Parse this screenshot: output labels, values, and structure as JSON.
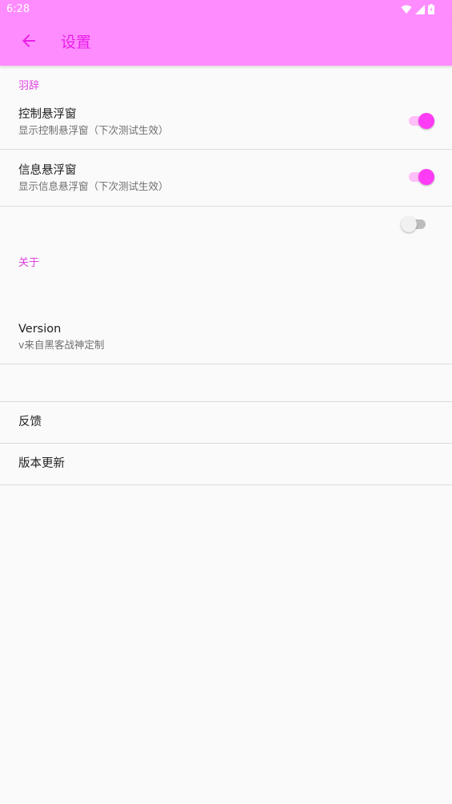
{
  "status_bar": {
    "time": "6:28",
    "icons": [
      "wifi-icon",
      "cell-signal-icon",
      "battery-icon"
    ]
  },
  "app_bar": {
    "title": "设置",
    "back_icon": "arrow-left-icon"
  },
  "colors": {
    "primary": "#ff8cff",
    "accent": "#ff3cf5",
    "title_text": "#e81ee8",
    "category_text": "#e040e0"
  },
  "sections": {
    "yuci": {
      "header": "羽辞",
      "control_floating": {
        "title": "控制悬浮窗",
        "summary": "显示控制悬浮窗（下次测试生效）",
        "enabled": true
      },
      "info_floating": {
        "title": "信息悬浮窗",
        "summary": "显示信息悬浮窗（下次测试生效）",
        "enabled": true
      },
      "unlabeled_toggle": {
        "enabled": false
      }
    },
    "about": {
      "header": "关于",
      "version": {
        "title": "Version",
        "summary": "v来自黑客战神定制"
      },
      "feedback": {
        "title": "反馈"
      },
      "update": {
        "title": "版本更新"
      }
    }
  }
}
